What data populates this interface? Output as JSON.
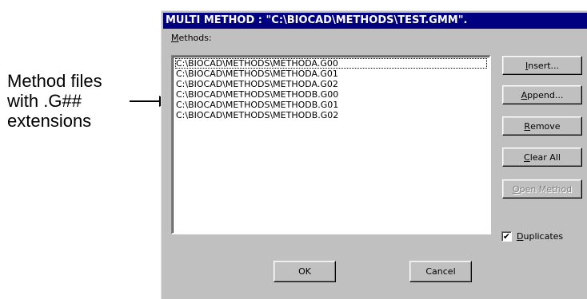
{
  "annotation": {
    "lines": [
      "Method files",
      "with .G##",
      "extensions"
    ]
  },
  "dialog": {
    "title": "MULTI METHOD : \"C:\\BIOCAD\\METHODS\\TEST.GMM\".",
    "methods_label_prefix": "",
    "methods_label_accel": "M",
    "methods_label_rest": "ethods:",
    "methods": [
      "C:\\BIOCAD\\METHODS\\METHODA.G00",
      "C:\\BIOCAD\\METHODS\\METHODA.G01",
      "C:\\BIOCAD\\METHODS\\METHODA.G02",
      "C:\\BIOCAD\\METHODS\\METHODB.G00",
      "C:\\BIOCAD\\METHODS\\METHODB.G01",
      "C:\\BIOCAD\\METHODS\\METHODB.G02"
    ],
    "buttons": {
      "insert": {
        "accel": "I",
        "rest": "nsert..."
      },
      "append": {
        "accel": "A",
        "rest": "ppend..."
      },
      "remove": {
        "accel": "R",
        "rest": "emove"
      },
      "clear_all": {
        "accel": "C",
        "rest": "lear All"
      },
      "open_method": {
        "accel": "O",
        "rest": "pen Method"
      },
      "ok": "OK",
      "cancel": "Cancel"
    },
    "duplicates": {
      "checked": true,
      "check_glyph": "✔",
      "accel": "D",
      "rest": "uplicates"
    }
  }
}
